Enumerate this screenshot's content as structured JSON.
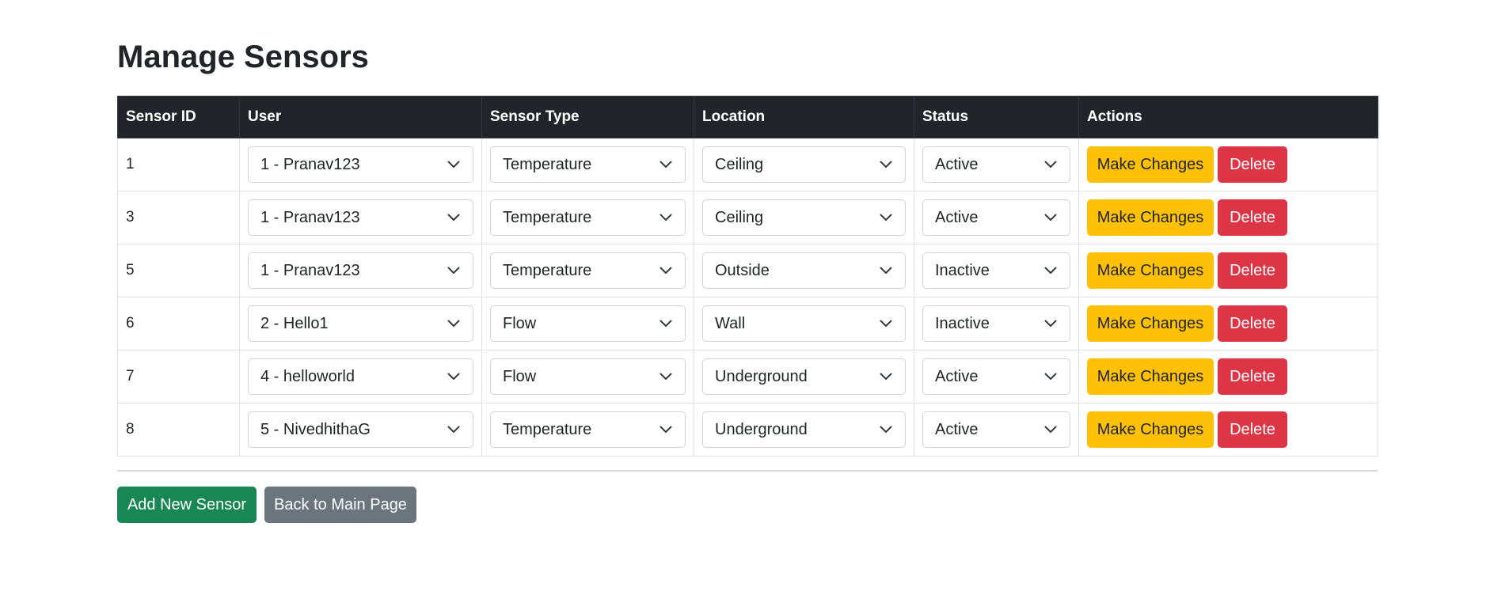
{
  "page": {
    "title": "Manage Sensors"
  },
  "table": {
    "headers": {
      "sensor_id": "Sensor ID",
      "user": "User",
      "sensor_type": "Sensor Type",
      "location": "Location",
      "status": "Status",
      "actions": "Actions"
    },
    "rows": [
      {
        "id": "1",
        "user": "1 - Pranav123",
        "type": "Temperature",
        "location": "Ceiling",
        "status": "Active"
      },
      {
        "id": "3",
        "user": "1 - Pranav123",
        "type": "Temperature",
        "location": "Ceiling",
        "status": "Active"
      },
      {
        "id": "5",
        "user": "1 - Pranav123",
        "type": "Temperature",
        "location": "Outside",
        "status": "Inactive"
      },
      {
        "id": "6",
        "user": "2 - Hello1",
        "type": "Flow",
        "location": "Wall",
        "status": "Inactive"
      },
      {
        "id": "7",
        "user": "4 - helloworld",
        "type": "Flow",
        "location": "Underground",
        "status": "Active"
      },
      {
        "id": "8",
        "user": "5 - NivedhithaG",
        "type": "Temperature",
        "location": "Underground",
        "status": "Active"
      }
    ],
    "make_changes_label": "Make Changes",
    "delete_label": "Delete"
  },
  "footer": {
    "add_label": "Add New Sensor",
    "back_label": "Back to Main Page"
  },
  "colors": {
    "header_bg": "#212529",
    "warning": "#ffc107",
    "danger": "#dc3545",
    "success": "#198754",
    "secondary": "#6c757d"
  },
  "icons": {
    "select_caret": "chevron-down-icon"
  }
}
